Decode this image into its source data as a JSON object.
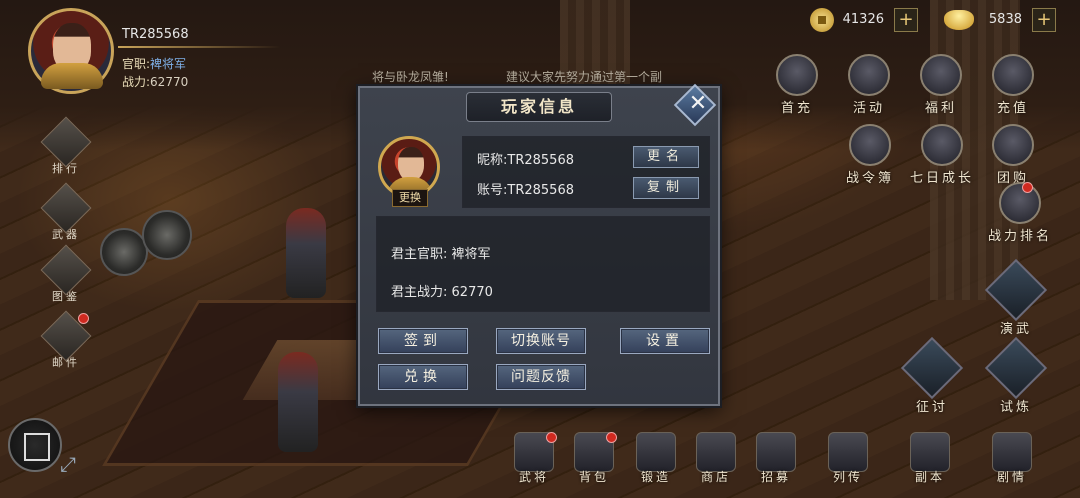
{
  "player": {
    "id": "TR285568",
    "rank_label": "官职:",
    "rank_value": "裨将军",
    "power_label": "战力:",
    "power_value": "62770"
  },
  "currency": {
    "coins": "41326",
    "gold": "5838",
    "plus": "+"
  },
  "left_menu": [
    {
      "label": "排行"
    },
    {
      "label": "武器"
    },
    {
      "label": "图鉴"
    },
    {
      "label": "邮件"
    }
  ],
  "marquee": {
    "left": "将与卧龙凤雏!",
    "right": "建议大家先努力通过第一个副"
  },
  "right_top": [
    {
      "label": "首充"
    },
    {
      "label": "活动"
    },
    {
      "label": "福利"
    },
    {
      "label": "充值"
    },
    {
      "label": "战令簿"
    },
    {
      "label": "七日成长"
    },
    {
      "label": "团购"
    },
    {
      "label": "战力排名"
    }
  ],
  "right_side": [
    {
      "label": "演武"
    },
    {
      "label": "征讨"
    },
    {
      "label": "试炼"
    }
  ],
  "bottom_bar": [
    {
      "label": "武将"
    },
    {
      "label": "背包"
    },
    {
      "label": "锻造"
    },
    {
      "label": "商店"
    },
    {
      "label": "招募"
    },
    {
      "label": "列传"
    },
    {
      "label": "副本"
    },
    {
      "label": "剧情"
    }
  ],
  "modal": {
    "title": "玩家信息",
    "close": "✕",
    "avatar_swap": "更换",
    "nickname_label": "昵称:",
    "nickname_value": "TR285568",
    "account_label": "账号:",
    "account_value": "TR285568",
    "rename_button": "更名",
    "copy_button": "复制",
    "official_label": "君主官职:",
    "official_value": "裨将军",
    "power_label": "君主战力:",
    "power_value": "62770",
    "buttons": {
      "sign_in": "签到",
      "switch_account": "切换账号",
      "settings": "设置",
      "redeem": "兑换",
      "feedback": "问题反馈"
    }
  },
  "colors": {
    "accent_gold": "#c9a45a",
    "rank_blue": "#7fb0e8",
    "notify_red": "#d02a20",
    "modal_bg": "#3e434d"
  }
}
